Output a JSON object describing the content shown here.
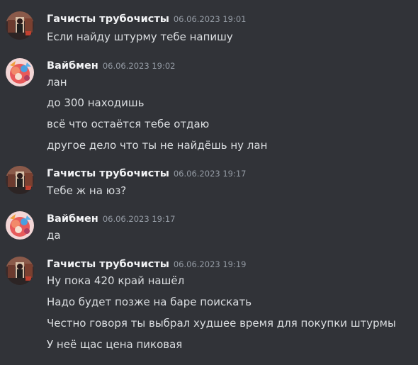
{
  "colors": {
    "background": "#313338",
    "author": "#f2f3f5",
    "timestamp": "#949ba4",
    "text": "#dbdee1"
  },
  "messages": [
    {
      "author": "Гачисты трубочисты",
      "timestamp": "06.06.2023 19:01",
      "avatar": "avatar-photo-icon",
      "lines": [
        "Если найду штурму тебе напишу"
      ]
    },
    {
      "author": "Вайбмен",
      "timestamp": "06.06.2023 19:02",
      "avatar": "avatar-anime-icon",
      "lines": [
        "лан",
        "до 300 находишь",
        "всё что остаётся тебе отдаю",
        "другое дело что ты не найдёшь ну лан"
      ]
    },
    {
      "author": "Гачисты трубочисты",
      "timestamp": "06.06.2023 19:17",
      "avatar": "avatar-photo-icon",
      "lines": [
        "Тебе ж на юз?"
      ]
    },
    {
      "author": "Вайбмен",
      "timestamp": "06.06.2023 19:17",
      "avatar": "avatar-anime-icon",
      "lines": [
        "да"
      ]
    },
    {
      "author": "Гачисты трубочисты",
      "timestamp": "06.06.2023 19:19",
      "avatar": "avatar-photo-icon",
      "lines": [
        "Ну пока 420 край нашёл",
        "Надо будет позже на баре поискать",
        "Честно говоря ты выбрал худшее время для покупки штурмы",
        "У неё щас цена пиковая"
      ]
    }
  ]
}
